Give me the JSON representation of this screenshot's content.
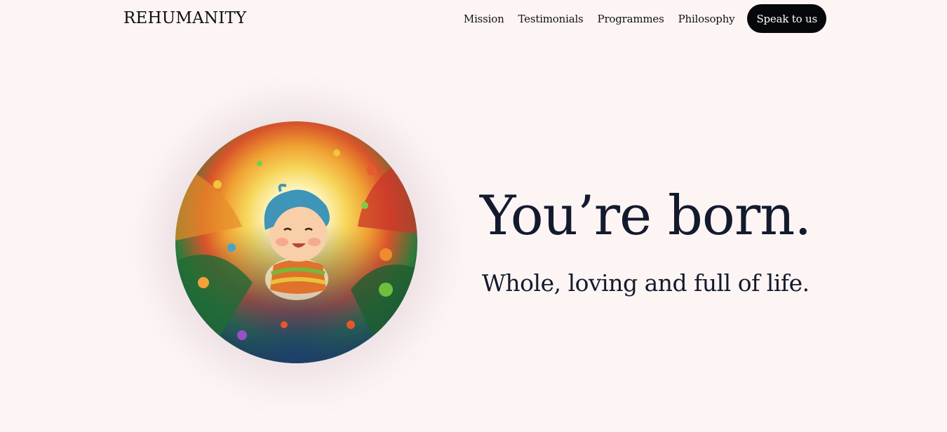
{
  "header": {
    "brand": "REHUMANITY",
    "nav": [
      "Mission",
      "Testimonials",
      "Programmes",
      "Philosophy"
    ],
    "cta_label": "Speak to us"
  },
  "hero": {
    "headline": "You’re born.",
    "subhead": "Whole, loving and full of life.",
    "image_icon": "baby-illustration"
  },
  "colors": {
    "background": "#fdf5f4",
    "text": "#141a2e",
    "cta_bg": "#06070b",
    "cta_text": "#ffffff"
  }
}
